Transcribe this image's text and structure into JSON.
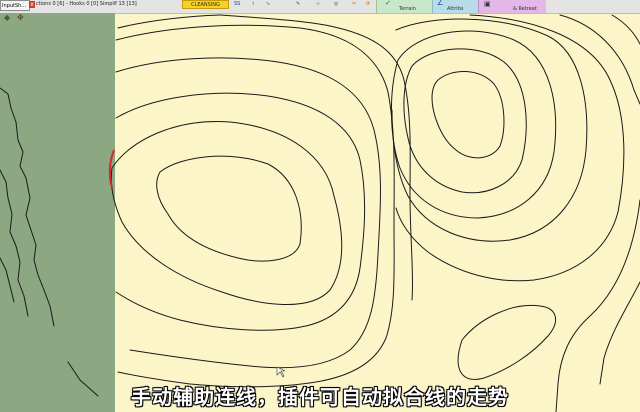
{
  "toolbar": {
    "panel_tab_label": "InputSh...",
    "close_glyph": "x",
    "status_line": "ctions 0 [6] - Hooks 0 [0] Simplif 13 [13]",
    "cleansing_label": "CLEANSING",
    "ss_label": "SS",
    "terrain_label": "Terrain",
    "attribs_label": "Attribs",
    "retreat_label": "& Retreat",
    "check_glyph": "✓",
    "accent_yellow": "#f5d12a",
    "terrain_color": "#c9e8c9",
    "attribs_color": "#b9dde8",
    "retreat_color": "#e3b8e8"
  },
  "side_panel": {
    "color": "#8ba882",
    "icons": [
      "layers-icon",
      "tools-icon"
    ]
  },
  "map": {
    "background": "#fbf5c8",
    "contour_color": "#1a1a1a",
    "highlight_color": "#d42a2a"
  },
  "subtitle": "手动辅助连线，插件可自动拟合线的走势"
}
